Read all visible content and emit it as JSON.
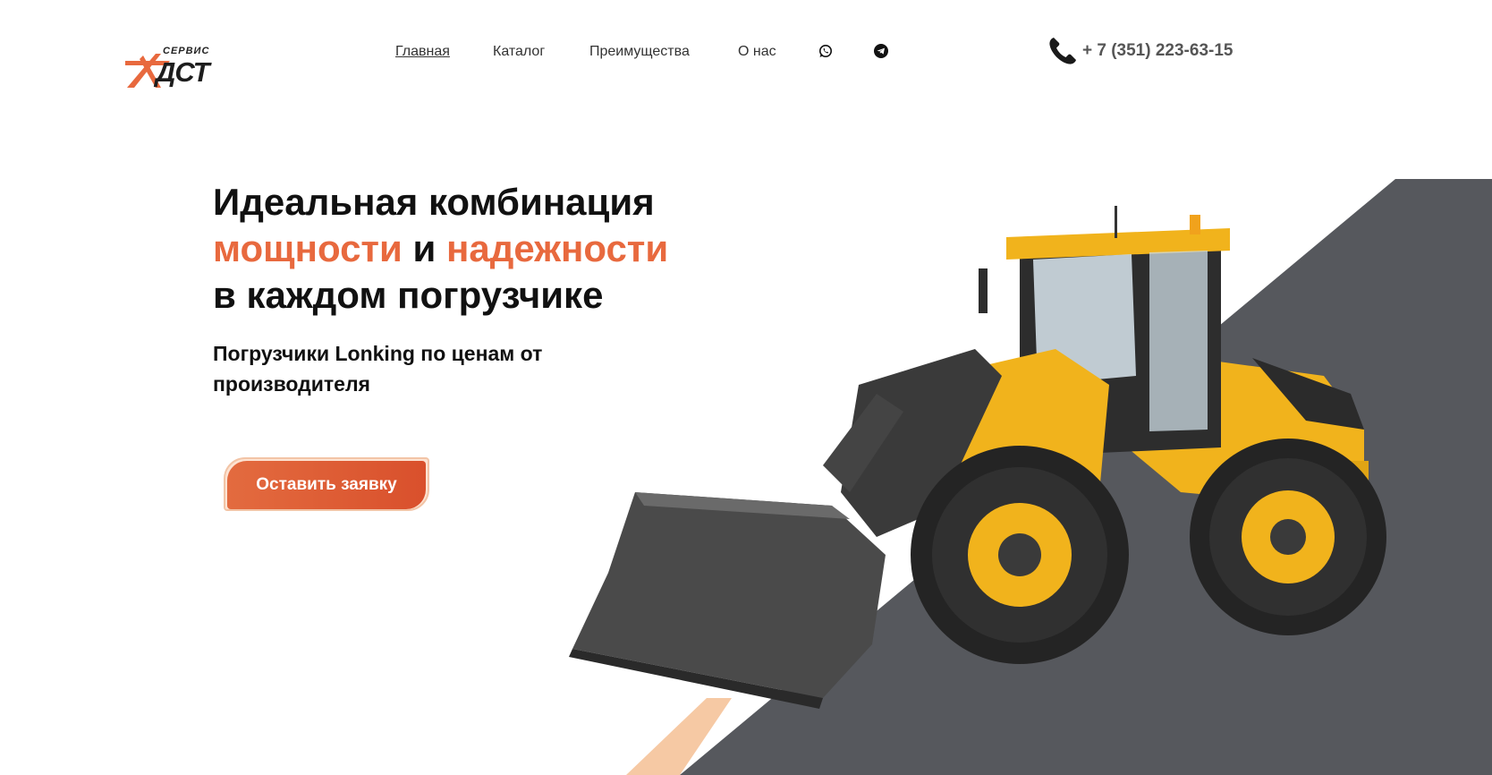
{
  "brand": {
    "logo_small": "СЕРВИС",
    "logo_main": "ДСТ",
    "accent_color": "#e8693e",
    "dark_color": "#56585d"
  },
  "nav": {
    "items": [
      {
        "label": "Главная",
        "active": true
      },
      {
        "label": "Каталог",
        "active": false
      },
      {
        "label": "Преимущества",
        "active": false
      },
      {
        "label": "О нас",
        "active": false
      }
    ],
    "icons": [
      "whatsapp-icon",
      "telegram-icon"
    ]
  },
  "contact": {
    "phone": "+ 7 (351) 223-63-15",
    "icon": "phone-icon"
  },
  "hero": {
    "line1": "Идеальная комбинация",
    "accent1": "мощности",
    "connector": "и",
    "accent2": "надежности",
    "line3": "в каждом погрузчике",
    "subtitle": "Погрузчики Lonking по ценам от производителя",
    "cta_label": "Оставить заявку"
  }
}
